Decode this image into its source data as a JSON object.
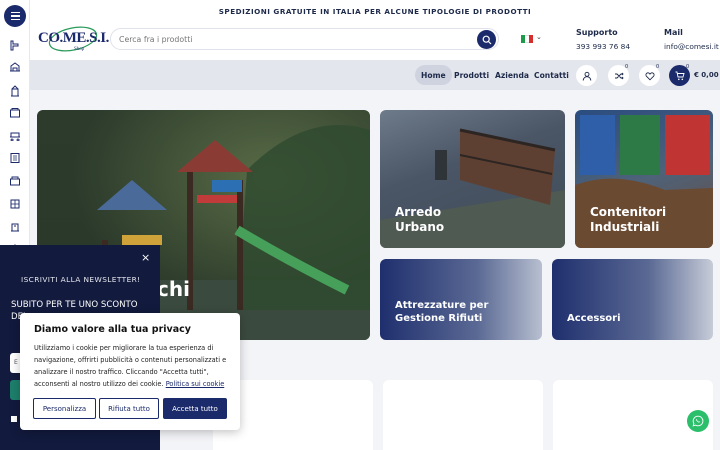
{
  "topbar": {
    "announcement": "SPEDIZIONI GRATUITE IN ITALIA PER ALCUNE TIPOLOGIE DI PRODOTTI"
  },
  "logo": {
    "text": "CO.ME.S.I.",
    "sub": "Shop"
  },
  "search": {
    "placeholder": "Cerca fra i prodotti"
  },
  "contacts": {
    "support_label": "Supporto",
    "support_value": "393 993 76 84",
    "mail_label": "Mail",
    "mail_value": "info@comesi.it"
  },
  "nav": {
    "items": [
      {
        "label": "Home",
        "active": true
      },
      {
        "label": "Prodotti"
      },
      {
        "label": "Azienda"
      },
      {
        "label": "Contatti"
      }
    ],
    "compare_count": "0",
    "wishlist_count": "0",
    "cart_count": "0",
    "cart_total": "€ 0,00"
  },
  "tiles": {
    "hero": "chi",
    "arredo_line1": "Arredo",
    "arredo_line2": "Urbano",
    "contenitori_line1": "Contenitori",
    "contenitori_line2": "Industriali",
    "rifiuti_line1": "Attrezzature per",
    "rifiuti_line2": "Gestione Rifiuti",
    "accessori": "Accessori"
  },
  "newsletter": {
    "close": "×",
    "title": "ISCRIVITI ALLA NEWSLETTER!",
    "offer": "SUBITO PER TE UNO SCONTO DEL",
    "input_placeholder": "E"
  },
  "cookie": {
    "title": "Diamo valore alla tua privacy",
    "body": "Utilizziamo i cookie per migliorare la tua esperienza di navigazione, offrirti pubblicità o contenuti personalizzati e analizzare il nostro traffico. Cliccando \"Accetta tutti\", acconsenti al nostro utilizzo dei cookie.",
    "policy_link": "Politica sui cookie",
    "customize": "Personalizza",
    "reject": "Rifiuta tutto",
    "accept": "Accetta tutto"
  },
  "colors": {
    "brand": "#1b2a6b",
    "whatsapp": "#2bbf6c",
    "newsletter_bg": "#121a3d"
  },
  "icons": [
    "menu-icon",
    "search-icon",
    "user-icon",
    "shuffle-icon",
    "heart-icon",
    "cart-icon",
    "whatsapp-icon"
  ]
}
